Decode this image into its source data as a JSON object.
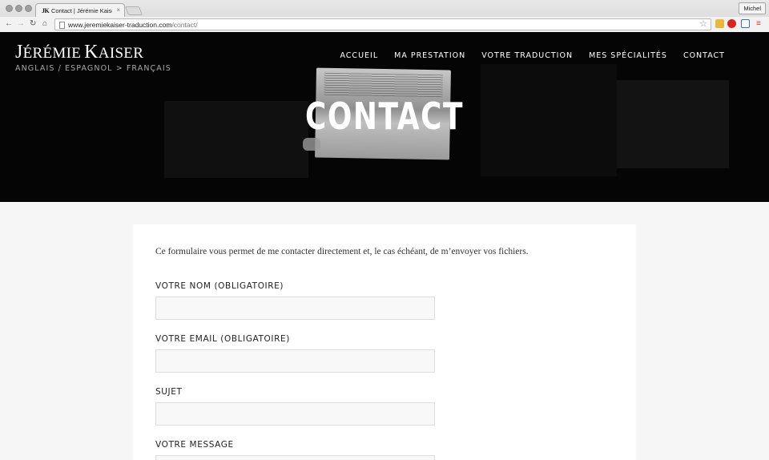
{
  "browser": {
    "tab_title": "Contact | Jérémie Kaiser Tra",
    "tab_favicon_text": "JK",
    "tab_close": "×",
    "profile_name": "Michel",
    "url_domain": "www.jeremiekaiser-traduction.com",
    "url_path": "/contact/",
    "icons": [
      "back-arrow-icon",
      "forward-arrow-icon",
      "reload-icon",
      "home-icon",
      "bookmark-star-icon",
      "menu-icon"
    ]
  },
  "site": {
    "logo_first_initial": "J",
    "logo_first_rest": "ÉRÉMIE",
    "logo_last_initial": "K",
    "logo_last_rest": "AISER",
    "tagline": "ANGLAIS / ESPAGNOL > FRANÇAIS",
    "nav": [
      "ACCUEIL",
      "MA PRESTATION",
      "VOTRE TRADUCTION",
      "MES SPÉCIALITÉS",
      "CONTACT"
    ],
    "page_heading": "CONTACT"
  },
  "form": {
    "intro": "Ce formulaire vous permet de me contacter directement et, le cas échéant, de m’envoyer vos fichiers.",
    "fields": [
      {
        "label": "VOTRE NOM (OBLIGATOIRE)",
        "value": ""
      },
      {
        "label": "VOTRE EMAIL (OBLIGATOIRE)",
        "value": ""
      },
      {
        "label": "SUJET",
        "value": ""
      },
      {
        "label": "VOTRE MESSAGE",
        "value": ""
      }
    ]
  },
  "colors": {
    "hero_bg": "#050505",
    "page_bg": "#f6f6f6",
    "card_bg": "#ffffff",
    "input_bg": "#f8f8f8",
    "input_border": "#dddddd"
  }
}
